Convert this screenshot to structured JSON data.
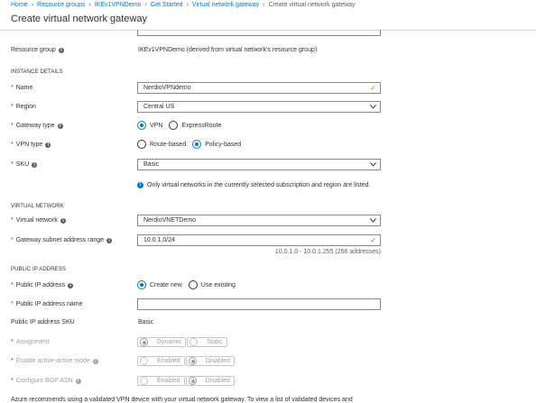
{
  "breadcrumb": {
    "items": [
      "Home",
      "Resource groups",
      "IKEv1VPNDemo",
      "Get Started",
      "Virtual network gateway"
    ],
    "current": "Create virtual network gateway"
  },
  "page": {
    "title": "Create virtual network gateway"
  },
  "resource_group": {
    "label": "Resource group",
    "value": "IKEv1VPNDemo (derived from virtual network's resource group)"
  },
  "instance_details": {
    "heading": "INSTANCE DETAILS",
    "name": {
      "label": "Name",
      "value": "NerdioVPNdemo"
    },
    "region": {
      "label": "Region",
      "value": "Central US"
    },
    "gateway_type": {
      "label": "Gateway type",
      "options": [
        "VPN",
        "ExpressRoute"
      ],
      "selected": "VPN"
    },
    "vpn_type": {
      "label": "VPN type",
      "options": [
        "Route-based",
        "Policy-based"
      ],
      "selected": "Policy-based"
    },
    "sku": {
      "label": "SKU",
      "value": "Basic"
    },
    "note": "Only virtual networks in the currently selected subscription and region are listed."
  },
  "virtual_network": {
    "heading": "VIRTUAL NETWORK",
    "network": {
      "label": "Virtual network",
      "value": "NerdioVNETDemo"
    },
    "subnet": {
      "label": "Gateway subnet address range",
      "value": "10.0.1.0/24",
      "hint": "10.0.1.0 - 10.0.1.255 (256 addresses)"
    }
  },
  "public_ip": {
    "heading": "PUBLIC IP ADDRESS",
    "address": {
      "label": "Public IP address",
      "options": [
        "Create new",
        "Use existing"
      ],
      "selected": "Create new"
    },
    "name": {
      "label": "Public IP address name",
      "value": ""
    },
    "sku": {
      "label": "Public IP address SKU",
      "value": "Basic"
    },
    "assignment": {
      "label": "Assignment",
      "options": [
        "Dynamic",
        "Static"
      ],
      "selected": "Dynamic"
    },
    "active_active": {
      "label": "Enable active-active mode",
      "options": [
        "Enabled",
        "Disabled"
      ],
      "selected": "Disabled"
    },
    "bgp": {
      "label": "Configure BGP ASN",
      "options": [
        "Enabled",
        "Disabled"
      ],
      "selected": "Disabled"
    }
  },
  "footer": {
    "text": "Azure recommends using a validated VPN device with your virtual network gateway. To view a list of validated devices and"
  },
  "colors": {
    "accent": "#0078d4",
    "valid": "#57a300",
    "required": "#a4262c"
  },
  "icons": [
    "info-icon",
    "checkmark-icon",
    "chevron-down-icon"
  ]
}
